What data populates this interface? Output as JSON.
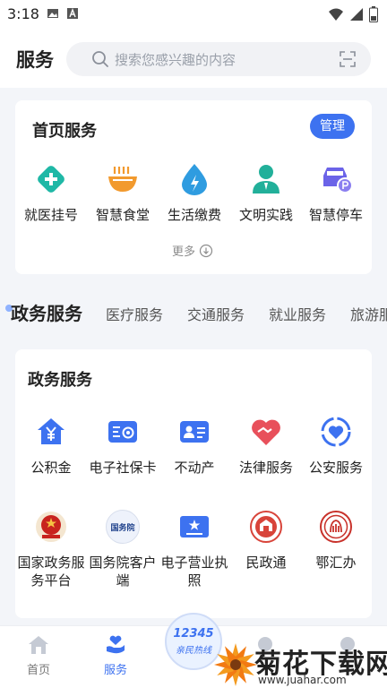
{
  "status_bar": {
    "time": "3:18"
  },
  "header": {
    "title": "服务",
    "search_placeholder": "搜索您感兴趣的内容"
  },
  "home_services": {
    "title": "首页服务",
    "manage_label": "管理",
    "more_label": "更多",
    "items": [
      {
        "label": "就医挂号",
        "icon": "medical-cross-icon",
        "color": "#1fb8a6"
      },
      {
        "label": "智慧食堂",
        "icon": "bowl-icon",
        "color": "#f29a2e"
      },
      {
        "label": "生活缴费",
        "icon": "water-drop-icon",
        "color": "#2f9ce0"
      },
      {
        "label": "文明实践",
        "icon": "person-icon",
        "color": "#22b09a"
      },
      {
        "label": "智慧停车",
        "icon": "parking-car-icon",
        "color": "#6b63e8"
      }
    ]
  },
  "category_tabs": {
    "active": "政务服务",
    "items": [
      "医疗服务",
      "交通服务",
      "就业服务",
      "旅游服"
    ]
  },
  "gov_services": {
    "title": "政务服务",
    "row1": [
      {
        "label": "公积金",
        "icon": "house-yen-icon"
      },
      {
        "label": "电子社保卡",
        "icon": "social-security-card-icon"
      },
      {
        "label": "不动产",
        "icon": "property-card-icon"
      },
      {
        "label": "法律服务",
        "icon": "heart-handshake-icon"
      },
      {
        "label": "公安服务",
        "icon": "police-badge-icon"
      }
    ],
    "row2": [
      {
        "label_line1": "国家政务服",
        "label_line2": "务平台",
        "icon": "national-emblem-icon"
      },
      {
        "label_line1": "国务院客户",
        "label_line2": "端",
        "icon": "state-council-icon",
        "icon_text": "国务院"
      },
      {
        "label_line1": "电子营业执",
        "label_line2": "照",
        "icon": "business-license-icon"
      },
      {
        "label_line1": "民政通",
        "label_line2": "",
        "icon": "civil-affairs-emblem-icon"
      },
      {
        "label_line1": "鄂汇办",
        "label_line2": "",
        "icon": "ehuiban-emblem-icon"
      }
    ]
  },
  "bottom_nav": {
    "home_label": "首页",
    "service_label": "服务",
    "hotline_number": "12345",
    "hotline_text": "亲民热线"
  },
  "watermark": {
    "title": "菊花下载网",
    "url": "www.juahar.com"
  },
  "colors": {
    "accent": "#3d72f0",
    "background": "#f3f5f9"
  }
}
